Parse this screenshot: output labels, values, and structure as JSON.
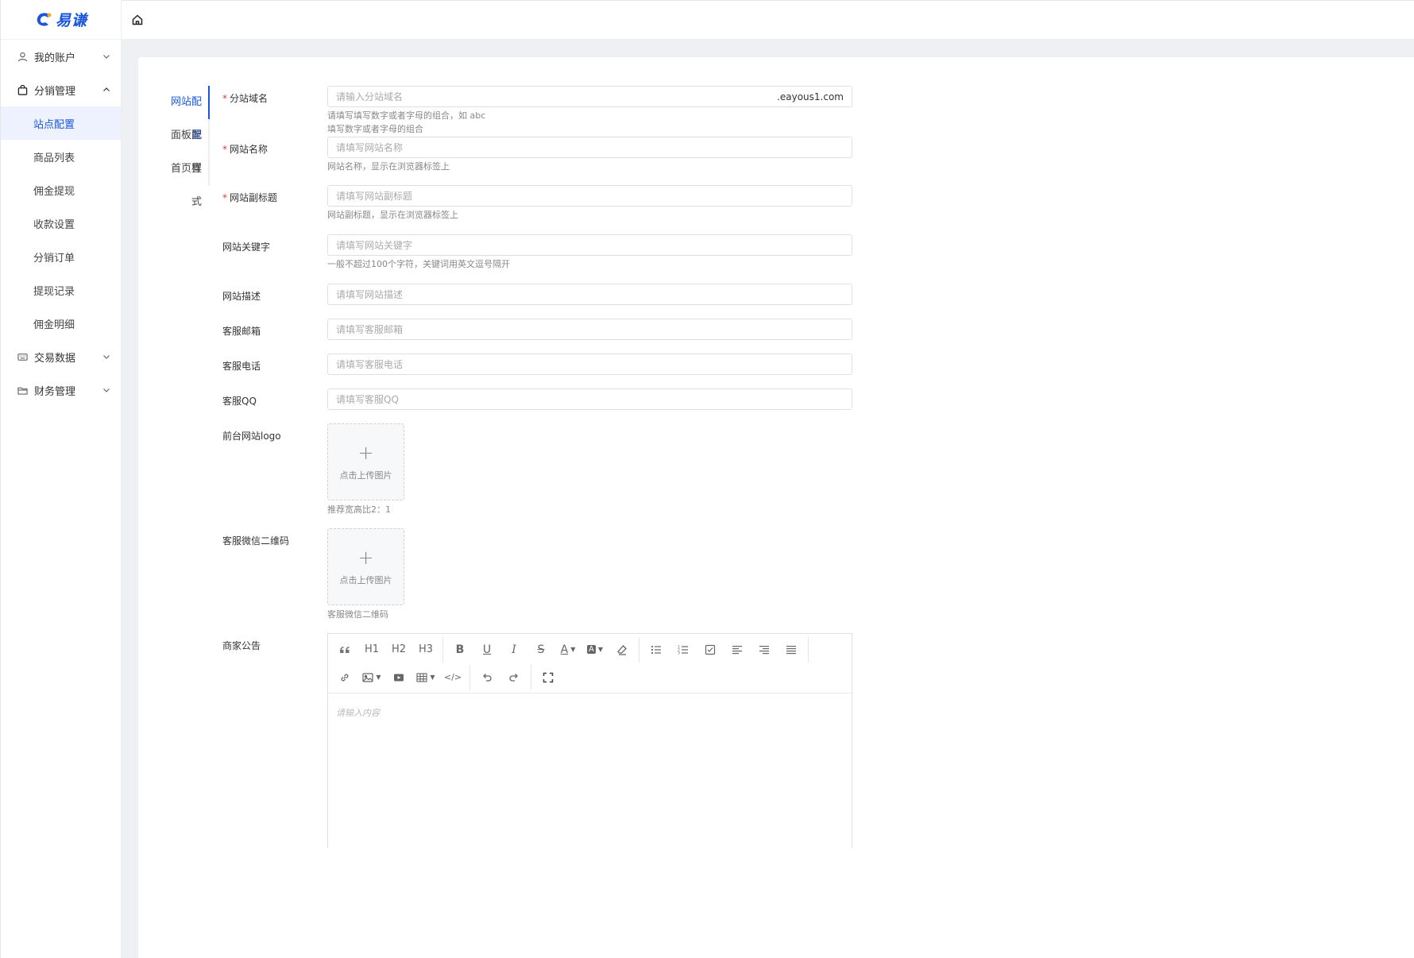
{
  "brand": {
    "name": "易谦",
    "accent": "#1a56db"
  },
  "sidebar": {
    "items": [
      {
        "label": "我的账户",
        "icon": "user-icon",
        "expanded": false
      },
      {
        "label": "分销管理",
        "icon": "bag-icon",
        "expanded": true,
        "children": [
          {
            "label": "站点配置",
            "active": true
          },
          {
            "label": "商品列表"
          },
          {
            "label": "佣金提现"
          },
          {
            "label": "收款设置"
          },
          {
            "label": "分销订单"
          },
          {
            "label": "提现记录"
          },
          {
            "label": "佣金明细"
          }
        ]
      },
      {
        "label": "交易数据",
        "icon": "keyboard-icon",
        "expanded": false
      },
      {
        "label": "财务管理",
        "icon": "folder-icon",
        "expanded": false
      }
    ]
  },
  "tabs": [
    {
      "label": "网站配置",
      "active": true
    },
    {
      "label": "面板配置"
    },
    {
      "label": "首页样式"
    }
  ],
  "form": {
    "domain": {
      "label": "分站域名",
      "required": true,
      "placeholder": "请输入分站域名",
      "suffix": ".eayous1.com",
      "hint1": "请填写填写数字或者字母的组合，如 abc",
      "hint2": "填写数字或者字母的组合"
    },
    "site_name": {
      "label": "网站名称",
      "required": true,
      "placeholder": "请填写网站名称",
      "hint": "网站名称，显示在浏览器标签上"
    },
    "subtitle": {
      "label": "网站副标题",
      "required": true,
      "placeholder": "请填写网站副标题",
      "hint": "网站副标题，显示在浏览器标签上"
    },
    "keywords": {
      "label": "网站关键字",
      "placeholder": "请填写网站关键字",
      "hint": "一般不超过100个字符，关键词用英文逗号隔开"
    },
    "description": {
      "label": "网站描述",
      "placeholder": "请填写网站描述"
    },
    "email": {
      "label": "客服邮箱",
      "placeholder": "请填写客服邮箱"
    },
    "phone": {
      "label": "客服电话",
      "placeholder": "请填写客服电话"
    },
    "qq": {
      "label": "客服QQ",
      "placeholder": "请填写客服QQ"
    },
    "logo": {
      "label": "前台网站logo",
      "upload_text": "点击上传图片",
      "hint": "推荐宽高比2：1"
    },
    "wechat_qr": {
      "label": "客服微信二维码",
      "upload_text": "点击上传图片",
      "hint": "客服微信二维码"
    },
    "notice": {
      "label": "商家公告",
      "placeholder": "请输入内容",
      "toolbar_row1": [
        "quote-icon",
        "H1",
        "H2",
        "H3",
        "bold-icon",
        "underline-icon",
        "italic-icon",
        "strikethrough-icon",
        "font-color-icon",
        "bg-color-icon",
        "clear-format-icon",
        "bullet-list-icon",
        "numbered-list-icon",
        "todo-icon",
        "align-left-icon",
        "align-right-icon",
        "justify-icon"
      ],
      "toolbar_row2": [
        "link-icon",
        "image-icon",
        "video-icon",
        "table-icon",
        "code-icon",
        "undo-icon",
        "redo-icon",
        "fullscreen-icon"
      ]
    }
  }
}
